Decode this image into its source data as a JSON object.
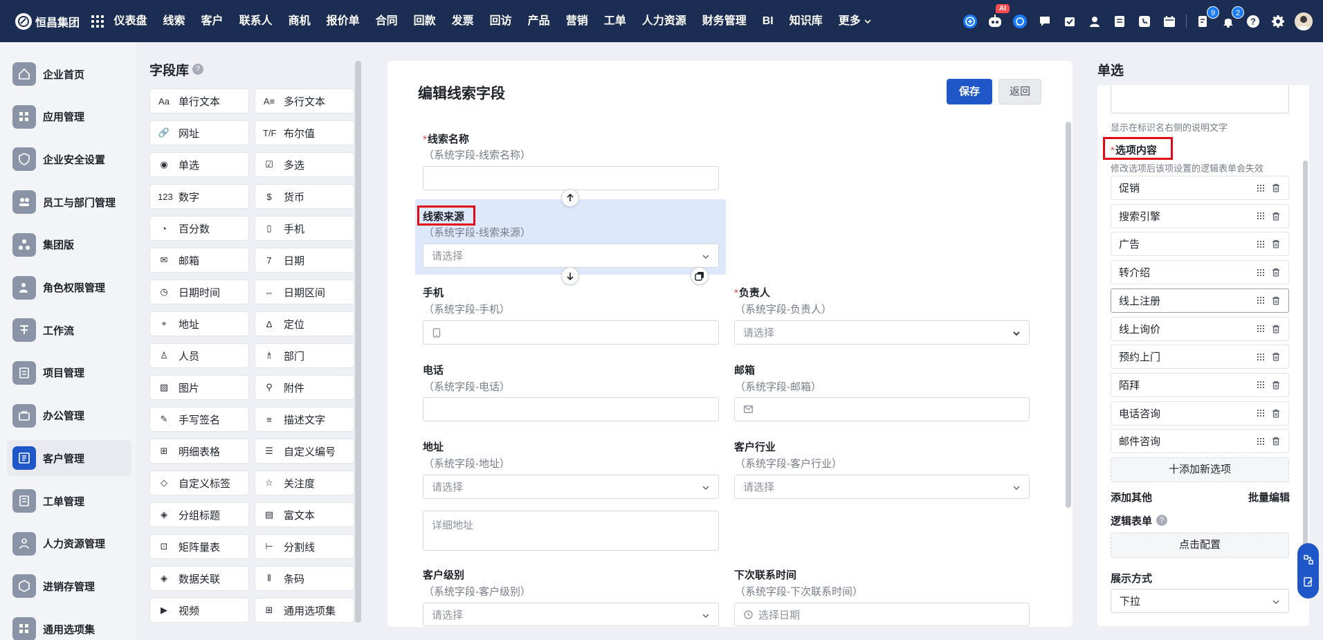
{
  "app": {
    "name": "恒昌集团"
  },
  "nav": {
    "items": [
      "仪表盘",
      "线索",
      "客户",
      "联系人",
      "商机",
      "报价单",
      "合同",
      "回款",
      "发票",
      "回访",
      "产品",
      "营销",
      "工单",
      "人力资源",
      "财务管理",
      "BI",
      "知识库"
    ],
    "more": "更多"
  },
  "top_icons": {
    "ai_label": "AI",
    "tasks_badge": "9",
    "notify_badge": "2",
    "icon_names": [
      "add-circle-icon",
      "ai-robot-icon",
      "chat-icon",
      "message-icon",
      "approval-icon",
      "contacts-icon",
      "document-icon",
      "phone-icon",
      "calendar-icon",
      "task-icon",
      "bell-icon",
      "help-icon",
      "settings-icon",
      "avatar"
    ]
  },
  "sidebar": {
    "items": [
      "企业首页",
      "应用管理",
      "企业安全设置",
      "员工与部门管理",
      "集团版",
      "角色权限管理",
      "工作流",
      "项目管理",
      "办公管理",
      "客户管理",
      "工单管理",
      "人力资源管理",
      "进销存管理",
      "通用选项集"
    ],
    "active_index": 9
  },
  "library": {
    "title": "字段库",
    "help": "?",
    "fields": [
      {
        "icon": "Aa",
        "label": "单行文本"
      },
      {
        "icon": "A≡",
        "label": "多行文本"
      },
      {
        "icon": "🔗",
        "label": "网址"
      },
      {
        "icon": "T/F",
        "label": "布尔值"
      },
      {
        "icon": "◉",
        "label": "单选"
      },
      {
        "icon": "☑",
        "label": "多选"
      },
      {
        "icon": "123",
        "label": "数字"
      },
      {
        "icon": "$",
        "label": "货币"
      },
      {
        "icon": "◔",
        "label": "百分数"
      },
      {
        "icon": "▯",
        "label": "手机"
      },
      {
        "icon": "✉",
        "label": "邮箱"
      },
      {
        "icon": "7",
        "label": "日期"
      },
      {
        "icon": "◷",
        "label": "日期时间"
      },
      {
        "icon": "⇔",
        "label": "日期区间"
      },
      {
        "icon": "⌖",
        "label": "地址"
      },
      {
        "icon": "Δ",
        "label": "定位"
      },
      {
        "icon": "♙",
        "label": "人员"
      },
      {
        "icon": "♗",
        "label": "部门"
      },
      {
        "icon": "▨",
        "label": "图片"
      },
      {
        "icon": "⚲",
        "label": "附件"
      },
      {
        "icon": "✎",
        "label": "手写签名"
      },
      {
        "icon": "≡",
        "label": "描述文字"
      },
      {
        "icon": "⊞",
        "label": "明细表格"
      },
      {
        "icon": "☰",
        "label": "自定义编号"
      },
      {
        "icon": "◇",
        "label": "自定义标签"
      },
      {
        "icon": "☆",
        "label": "关注度"
      },
      {
        "icon": "◈",
        "label": "分组标题"
      },
      {
        "icon": "▤",
        "label": "富文本"
      },
      {
        "icon": "⊡",
        "label": "矩阵量表"
      },
      {
        "icon": "⊢",
        "label": "分割线"
      },
      {
        "icon": "◈",
        "label": "数据关联"
      },
      {
        "icon": "⦀",
        "label": "条码"
      },
      {
        "icon": "▶",
        "label": "视频"
      },
      {
        "icon": "⊞",
        "label": "通用选项集"
      }
    ]
  },
  "editor": {
    "title": "编辑线索字段",
    "save": "保存",
    "back": "返回",
    "fields": {
      "name": {
        "label": "线索名称",
        "sub": "（系统字段-线索名称）",
        "required": "*"
      },
      "source": {
        "label": "线索来源",
        "sub": "（系统字段-线索来源）",
        "placeholder": "请选择"
      },
      "mobile": {
        "label": "手机",
        "sub": "（系统字段-手机）"
      },
      "owner": {
        "label": "负责人",
        "sub": "（系统字段-负责人）",
        "required": "*",
        "placeholder": "请选择"
      },
      "phone": {
        "label": "电话",
        "sub": "（系统字段-电话）"
      },
      "email": {
        "label": "邮箱",
        "sub": "（系统字段-邮箱）"
      },
      "address": {
        "label": "地址",
        "sub": "（系统字段-地址）",
        "placeholder": "请选择",
        "detail_placeholder": "详细地址"
      },
      "industry": {
        "label": "客户行业",
        "sub": "（系统字段-客户行业）",
        "placeholder": "请选择"
      },
      "level": {
        "label": "客户级别",
        "sub": "（系统字段-客户级别）",
        "placeholder": "请选择"
      },
      "next_contact": {
        "label": "下次联系时间",
        "sub": "（系统字段-下次联系时间）",
        "placeholder": "选择日期"
      }
    }
  },
  "props": {
    "title": "单选",
    "desc_hint": "显示在标识名右侧的说明文字",
    "options_label": "选项内容",
    "options_required": "*",
    "options_hint": "修改选项后该项设置的逻辑表单会失效",
    "options": [
      "促销",
      "搜索引擎",
      "广告",
      "转介绍",
      "线上注册",
      "线上询价",
      "预约上门",
      "陌拜",
      "电话咨询",
      "邮件咨询"
    ],
    "selected_option_index": 4,
    "add_option": "十添加新选项",
    "add_other": "添加其他",
    "batch_edit": "批量编辑",
    "logic_form": "逻辑表单",
    "configure": "点击配置",
    "display_mode_label": "展示方式",
    "display_mode": "下拉"
  },
  "colors": {
    "topbar": "#1b2d52",
    "primary": "#1f56c8",
    "highlight": "#dde8fb",
    "red_annotation": "#e00b16"
  }
}
